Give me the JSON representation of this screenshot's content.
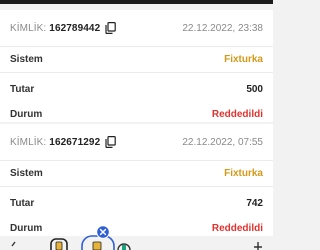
{
  "transactions": [
    {
      "id_label": "KİMLİK:",
      "id_value": "162789442",
      "date": "22.12.2022, 23:38",
      "system_label": "Sistem",
      "system_value": "Fixturka",
      "amount_label": "Tutar",
      "amount_value": "500",
      "status_label": "Durum",
      "status_value": "Reddedildi"
    },
    {
      "id_label": "KİMLİK:",
      "id_value": "162671292",
      "date": "22.12.2022, 07:55",
      "system_label": "Sistem",
      "system_value": "Fixturka",
      "amount_label": "Tutar",
      "amount_value": "742",
      "status_label": "Durum",
      "status_value": "Reddedildi"
    }
  ],
  "colors": {
    "brand": "#d29a18",
    "rejected": "#e0332f",
    "badge": "#2f5fd6"
  },
  "icons": {
    "copy": "copy-icon",
    "nav": [
      "chevron-left-icon",
      "wallet-icon",
      "active-tab-icon",
      "close-badge-icon",
      "nav-icon",
      "plus-icon"
    ]
  }
}
